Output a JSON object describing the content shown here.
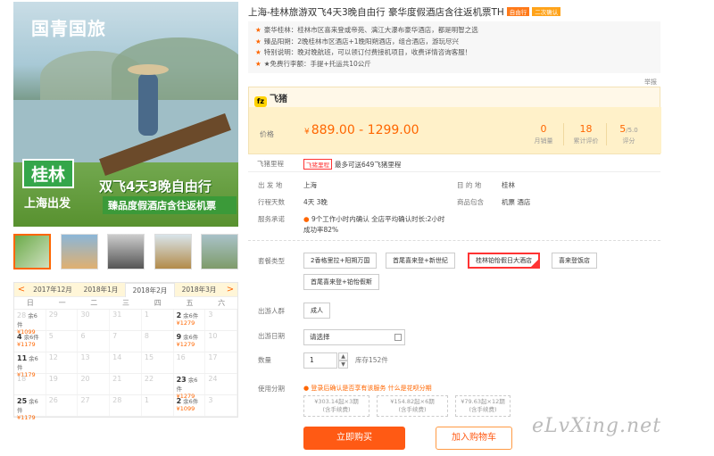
{
  "hero": {
    "brand": "国青国旅",
    "city": "桂林",
    "origin": "上海出发",
    "headline": "双飞4天3晚自由行",
    "subline": "臻品度假酒店含往返机票"
  },
  "thumbnails": [
    "缩略图1",
    "缩略图2",
    "缩略图3",
    "缩略图4",
    "缩略图5"
  ],
  "calendar": {
    "prev_arrow": "<",
    "next_arrow": ">",
    "months": [
      "2017年12月",
      "2018年1月",
      "2018年2月",
      "2018年3月"
    ],
    "selected_month": "2018年2月",
    "weekdays": [
      "日",
      "一",
      "二",
      "三",
      "四",
      "五",
      "六"
    ],
    "rows": [
      [
        {
          "d": "28",
          "s": "余6件",
          "p": "¥1099"
        },
        {
          "d": "29"
        },
        {
          "d": "30"
        },
        {
          "d": "31"
        },
        {
          "d": "1"
        },
        {
          "d": "2",
          "s": "余6件",
          "p": "¥1279",
          "b": true
        },
        {
          "d": "3"
        }
      ],
      [
        {
          "d": "4",
          "s": "余6件",
          "p": "¥1179",
          "b": true
        },
        {
          "d": "5"
        },
        {
          "d": "6"
        },
        {
          "d": "7"
        },
        {
          "d": "8"
        },
        {
          "d": "9",
          "s": "余6件",
          "p": "¥1279",
          "b": true
        },
        {
          "d": "10"
        }
      ],
      [
        {
          "d": "11",
          "s": "余6件",
          "p": "¥1179",
          "b": true
        },
        {
          "d": "12"
        },
        {
          "d": "13"
        },
        {
          "d": "14"
        },
        {
          "d": "15"
        },
        {
          "d": "16"
        },
        {
          "d": "17"
        }
      ],
      [
        {
          "d": "18"
        },
        {
          "d": "19"
        },
        {
          "d": "20"
        },
        {
          "d": "21"
        },
        {
          "d": "22"
        },
        {
          "d": "23",
          "s": "余6件",
          "p": "¥1279",
          "b": true
        },
        {
          "d": "24"
        }
      ],
      [
        {
          "d": "25",
          "s": "余6件",
          "p": "¥1179",
          "b": true
        },
        {
          "d": "26"
        },
        {
          "d": "27"
        },
        {
          "d": "28"
        },
        {
          "d": "1"
        },
        {
          "d": "2",
          "s": "余6件",
          "p": "¥1099",
          "b": true
        },
        {
          "d": "3"
        }
      ]
    ]
  },
  "product": {
    "title": "上海-桂林旅游双飞4天3晚自由行 豪华度假酒店含往返机票TH",
    "tag1": "自由行",
    "tag2": "二次确认",
    "tag1_color": "#ff7a1a",
    "tag2_color": "#ffa31a",
    "highlights": [
      {
        "k": "豪华桂林：",
        "v": "桂林市区喜来登或帝苑、漓江大瀑布豪华酒店，都是明智之选"
      },
      {
        "k": "臻品阳朔：",
        "v": "2晚桂林市区酒店+1晚阳朔酒店，组合酒店，游玩尽兴"
      },
      {
        "k": "特别说明：",
        "v": "晚对晚航班，可以领订付费接机项目，收费详情咨询客服！"
      },
      {
        "k": "★免费行李额：",
        "v": "手提+托运共10公斤"
      }
    ],
    "report": "举报"
  },
  "pricing": {
    "platform": "飞猪",
    "logo_glyph": "fz",
    "price_label": "价格",
    "currency": "¥",
    "price_range": "889.00 - 1299.00",
    "stats": [
      {
        "value": "0",
        "sub": "",
        "label": "月销量"
      },
      {
        "value": "18",
        "sub": "",
        "label": "累计评价"
      },
      {
        "value": "5",
        "sub": "/5.0",
        "label": "评分"
      }
    ]
  },
  "info": {
    "miles_label": "飞猪里程",
    "miles_badge": "飞猪里程",
    "miles_text": "最多可送649飞猪里程",
    "depart_label": "出 发 地",
    "depart": "上海",
    "dest_label": "目 的 地",
    "dest": "桂林",
    "days_label": "行程天数",
    "days": "4天  3晚",
    "includes_label": "商品包含",
    "includes": "机票  酒店",
    "service_label": "服务承诺",
    "service_line1": "9个工作小时内确认 全店平均确认时长:2小时",
    "service_line2": "成功率82%"
  },
  "options": {
    "package_label": "套餐类型",
    "packages": [
      "2香格里拉+阳朔万国",
      "首尾喜来登+新世纪",
      "桂林铂怡假日大酒店",
      "喜来登饭店",
      "首尾喜来登+铂怡假斯"
    ],
    "selected_package": "桂林铂怡假日大酒店",
    "group_label": "出游人群",
    "group": "成人",
    "date_label": "出游日期",
    "date_placeholder": "请选择",
    "qty_label": "数量",
    "qty": "1",
    "stock": "库存152件",
    "installment_label": "使用分期",
    "installment_note": "登录后确认是否享有该服务",
    "installment_link": "什么是花呗分期",
    "plans": [
      {
        "l1": "¥303.14起×3期",
        "l2": "(含手续费)"
      },
      {
        "l1": "¥154.82起×6期",
        "l2": "(含手续费)"
      },
      {
        "l1": "¥79.63起×12期",
        "l2": "(含手续费)"
      }
    ]
  },
  "actions": {
    "buy": "立即购买",
    "cart": "加入购物车"
  },
  "watermark": "eLvXing.net"
}
